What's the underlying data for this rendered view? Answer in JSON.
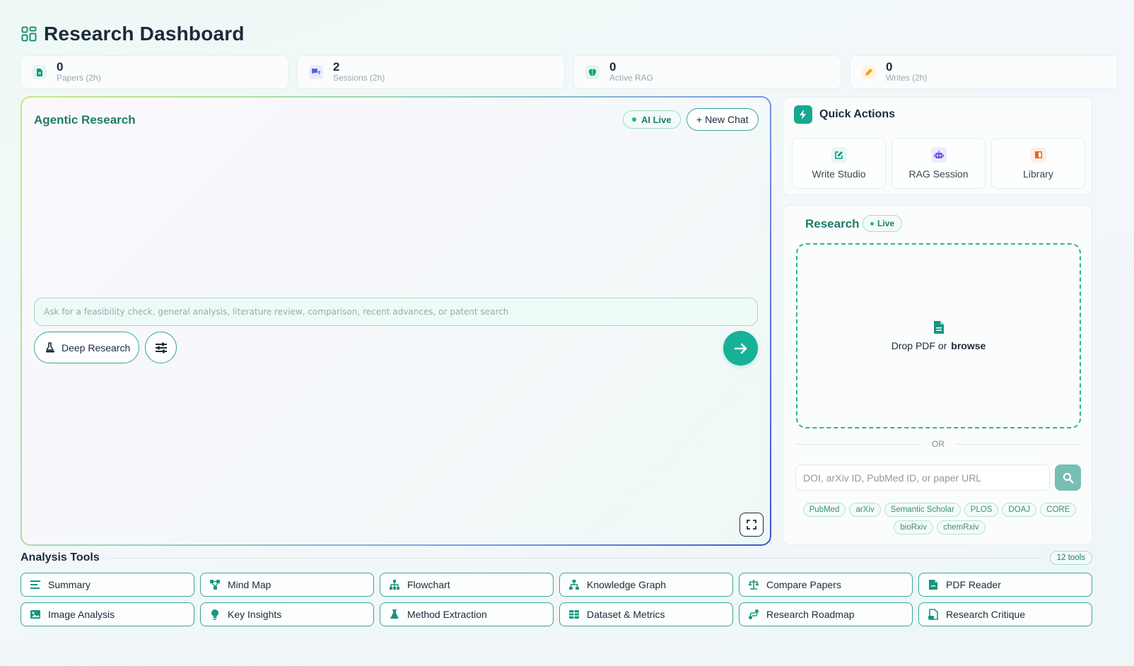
{
  "header": {
    "title": "Research Dashboard",
    "icon": "dashboard-grid-icon"
  },
  "stats": [
    {
      "value": "0",
      "label": "Papers (2h)",
      "icon": "paper-icon",
      "color": "#15977f"
    },
    {
      "value": "2",
      "label": "Sessions (2h)",
      "icon": "chat-bubbles-icon",
      "color": "#5b63d8"
    },
    {
      "value": "0",
      "label": "Active RAG",
      "icon": "brain-icon",
      "color": "#13a07e"
    },
    {
      "value": "0",
      "label": "Writes (2h)",
      "icon": "pencil-icon",
      "color": "#f0a020"
    }
  ],
  "agentic": {
    "title": "Agentic Research",
    "ai_live": "AI Live",
    "new_chat": "+ New Chat",
    "prompt_placeholder": "Ask for a feasibility check, general analysis, literature review, comparison, recent advances, or patent search",
    "deep_research": "Deep Research"
  },
  "quick_actions": {
    "title": "Quick Actions",
    "items": [
      {
        "label": "Write Studio",
        "icon": "edit-icon",
        "color": "#15977f"
      },
      {
        "label": "RAG Session",
        "icon": "robot-icon",
        "color": "#6c5ce7"
      },
      {
        "label": "Library",
        "icon": "book-icon",
        "color": "#e8671e"
      }
    ]
  },
  "research": {
    "title": "Research",
    "live": "Live",
    "drop_text": "Drop PDF or",
    "browse": "browse",
    "or": "OR",
    "doi_placeholder": "DOI, arXiv ID, PubMed ID, or paper URL",
    "sources": [
      "PubMed",
      "arXiv",
      "Semantic Scholar",
      "PLOS",
      "DOAJ",
      "CORE",
      "bioRxiv",
      "chemRxiv"
    ]
  },
  "tools": {
    "title": "Analysis Tools",
    "count": "12 tools",
    "items": [
      {
        "label": "Summary",
        "icon": "summary-lines-icon"
      },
      {
        "label": "Mind Map",
        "icon": "mind-map-icon"
      },
      {
        "label": "Flowchart",
        "icon": "flowchart-icon"
      },
      {
        "label": "Knowledge Graph",
        "icon": "knowledge-graph-icon"
      },
      {
        "label": "Compare Papers",
        "icon": "scale-icon"
      },
      {
        "label": "PDF Reader",
        "icon": "pdf-file-icon"
      },
      {
        "label": "Image Analysis",
        "icon": "image-icon"
      },
      {
        "label": "Key Insights",
        "icon": "lightbulb-icon"
      },
      {
        "label": "Method Extraction",
        "icon": "flask-icon"
      },
      {
        "label": "Dataset & Metrics",
        "icon": "table-icon"
      },
      {
        "label": "Research Roadmap",
        "icon": "route-icon"
      },
      {
        "label": "Research Critique",
        "icon": "critique-file-icon"
      }
    ]
  },
  "colors": {
    "accent": "#17b196",
    "accent_dark": "#1e7a6a",
    "border": "#3aa691"
  }
}
